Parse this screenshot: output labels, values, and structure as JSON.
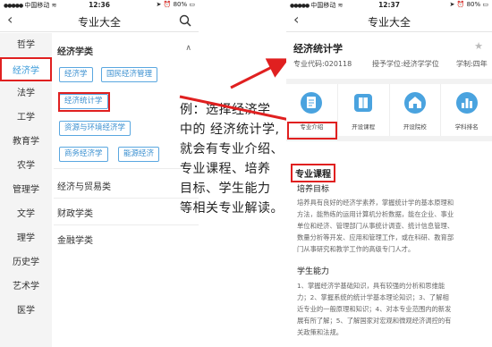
{
  "left_phone": {
    "status": {
      "carrier": "中国移动",
      "time": "12:36",
      "battery": "80%"
    },
    "nav": {
      "back": "‹",
      "title": "专业大全"
    },
    "sidebar": [
      {
        "label": "哲学"
      },
      {
        "label": "经济学",
        "active": true
      },
      {
        "label": "法学"
      },
      {
        "label": "工学"
      },
      {
        "label": "教育学"
      },
      {
        "label": "农学"
      },
      {
        "label": "管理学"
      },
      {
        "label": "文学"
      },
      {
        "label": "理学"
      },
      {
        "label": "历史学"
      },
      {
        "label": "艺术学"
      },
      {
        "label": "医学"
      }
    ],
    "category": {
      "header": "经济学类",
      "chevron": "∧",
      "tags": [
        "经济学",
        "国民经济管理",
        "经济统计学",
        "资源与环境经济学",
        "商务经济学",
        "能源经济"
      ]
    },
    "groups": [
      "经济与贸易类",
      "财政学类",
      "金融学类"
    ]
  },
  "annotation": {
    "lines": [
      "例：选择经济学",
      "中的 经济统计学,",
      "就会有专业介绍、",
      "专业课程、培养",
      "目标、学生能力",
      "等相关专业解读。"
    ]
  },
  "right_phone": {
    "status": {
      "carrier": "中国移动",
      "time": "12:37",
      "battery": "80%"
    },
    "nav": {
      "back": "‹",
      "title": "专业大全"
    },
    "major": {
      "name": "经济统计学",
      "code": "专业代码:020118",
      "degree": "授予学位:经济学学位",
      "duration": "学制:四年"
    },
    "tiles": [
      {
        "label": "专业介绍",
        "icon": "document-icon"
      },
      {
        "label": "开设课程",
        "icon": "book-icon"
      },
      {
        "label": "开设院校",
        "icon": "school-icon"
      },
      {
        "label": "学科排名",
        "icon": "ranking-icon"
      }
    ],
    "section_title": "专业课程",
    "training": {
      "title": "培养目标",
      "lines": [
        "培养具有良好的经济学素养，掌握统计学的基本原理和",
        "方法，能熟练的运用计算机分析数据，能在企业、事业",
        "单位和经济、管理部门从事统计调查、统计信息管理、",
        "数量分析等开发、应用和管理工作，或在科研、教育部",
        "门从事研究和教学工作的高级专门人才。"
      ]
    },
    "ability": {
      "title": "学生能力",
      "lines": [
        "1、掌握经济学基础知识，具有较强的分析和思维能",
        "力；2、掌握系统的统计学基本理论知识；3、了解相",
        "近专业的一般原理和知识；4、对本专业范围内的新发",
        "展有所了解；5、了解国家对宏观和微观经济调控的有",
        "关政策和法规。"
      ]
    }
  },
  "colors": {
    "accent": "#3a9ad9",
    "annotation_red": "#e02020"
  }
}
